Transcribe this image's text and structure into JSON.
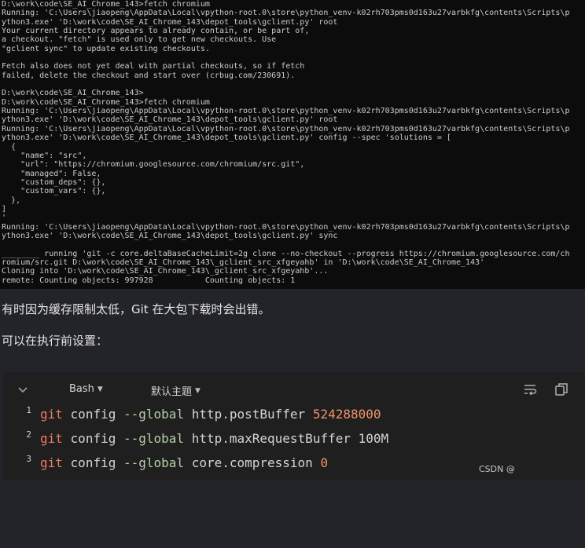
{
  "terminal": {
    "lines": [
      "D:\\work\\code\\SE_AI_Chrome_143>fetch chromium",
      "Running: 'C:\\Users\\jiaopeng\\AppData\\Local\\vpython-root.0\\store\\python_venv-k02rh703pms0d163u27varbkfg\\contents\\Scripts\\p",
      "ython3.exe' 'D:\\work\\code\\SE_AI_Chrome_143\\depot_tools\\gclient.py' root",
      "Your current directory appears to already contain, or be part of,",
      "a checkout. \"fetch\" is used only to get new checkouts. Use",
      "\"gclient sync\" to update existing checkouts.",
      "",
      "Fetch also does not yet deal with partial checkouts, so if fetch",
      "failed, delete the checkout and start over (crbug.com/230691).",
      "",
      "D:\\work\\code\\SE_AI_Chrome_143>",
      "D:\\work\\code\\SE_AI_Chrome_143>fetch chromium",
      "Running: 'C:\\Users\\jiaopeng\\AppData\\Local\\vpython-root.0\\store\\python_venv-k02rh703pms0d163u27varbkfg\\contents\\Scripts\\p",
      "ython3.exe' 'D:\\work\\code\\SE_AI_Chrome_143\\depot_tools\\gclient.py' root",
      "Running: 'C:\\Users\\jiaopeng\\AppData\\Local\\vpython-root.0\\store\\python_venv-k02rh703pms0d163u27varbkfg\\contents\\Scripts\\p",
      "ython3.exe' 'D:\\work\\code\\SE_AI_Chrome_143\\depot_tools\\gclient.py' config --spec 'solutions = [",
      "  {",
      "    \"name\": \"src\",",
      "    \"url\": \"https://chromium.googlesource.com/chromium/src.git\",",
      "    \"managed\": False,",
      "    \"custom_deps\": {},",
      "    \"custom_vars\": {},",
      "  },",
      "]",
      "'",
      "Running: 'C:\\Users\\jiaopeng\\AppData\\Local\\vpython-root.0\\store\\python_venv-k02rh703pms0d163u27varbkfg\\contents\\Scripts\\p",
      "ython3.exe' 'D:\\work\\code\\SE_AI_Chrome_143\\depot_tools\\gclient.py' sync",
      "",
      "________ running 'git -c core.deltaBaseCacheLimit=2g clone --no-checkout --progress https://chromium.googlesource.com/ch",
      "romium/src.git D:\\work\\code\\SE_AI_Chrome_143\\_gclient_src_xfgeyahb' in 'D:\\work\\code\\SE_AI_Chrome_143'",
      "Cloning into 'D:\\work\\code\\SE_AI_Chrome_143\\_gclient_src_xfgeyahb'...",
      "remote: Counting objects: 997928           Counting objects: 1"
    ]
  },
  "article": {
    "para1": "有时因为缓存限制太低，Git 在大包下载时会出错。",
    "para2": "可以在执行前设置："
  },
  "code_block": {
    "language": "Bash",
    "theme": "默认主题",
    "lines": [
      {
        "num": "1",
        "cmd": "git",
        "sub": "config",
        "flag": "--global",
        "key": "http.postBuffer",
        "value": "524288000"
      },
      {
        "num": "2",
        "cmd": "git",
        "sub": "config",
        "flag": "--global",
        "key": "http.maxRequestBuffer",
        "value": "100M"
      },
      {
        "num": "3",
        "cmd": "git",
        "sub": "config",
        "flag": "--global",
        "key": "core.compression",
        "value": "0"
      }
    ],
    "colors": {
      "cmd": "#f07860",
      "flag": "#b5cea8",
      "number": "#f0956a"
    },
    "icons": [
      "chevron-down-icon",
      "wrap-lines-icon",
      "copy-icon"
    ]
  },
  "watermark": "CSDN @"
}
